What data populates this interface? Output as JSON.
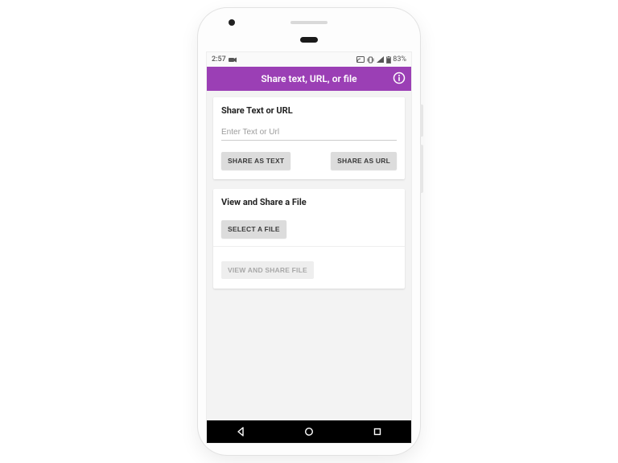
{
  "status": {
    "time": "2:57",
    "battery_percent": "83%"
  },
  "appbar": {
    "title": "Share text, URL, or file"
  },
  "card_text": {
    "title": "Share Text or URL",
    "placeholder": "Enter Text or Url",
    "value": "",
    "btn_text": "SHARE AS TEXT",
    "btn_url": "SHARE AS URL"
  },
  "card_file": {
    "title": "View and Share a File",
    "btn_select": "SELECT A FILE",
    "btn_view": "VIEW AND SHARE FILE"
  }
}
